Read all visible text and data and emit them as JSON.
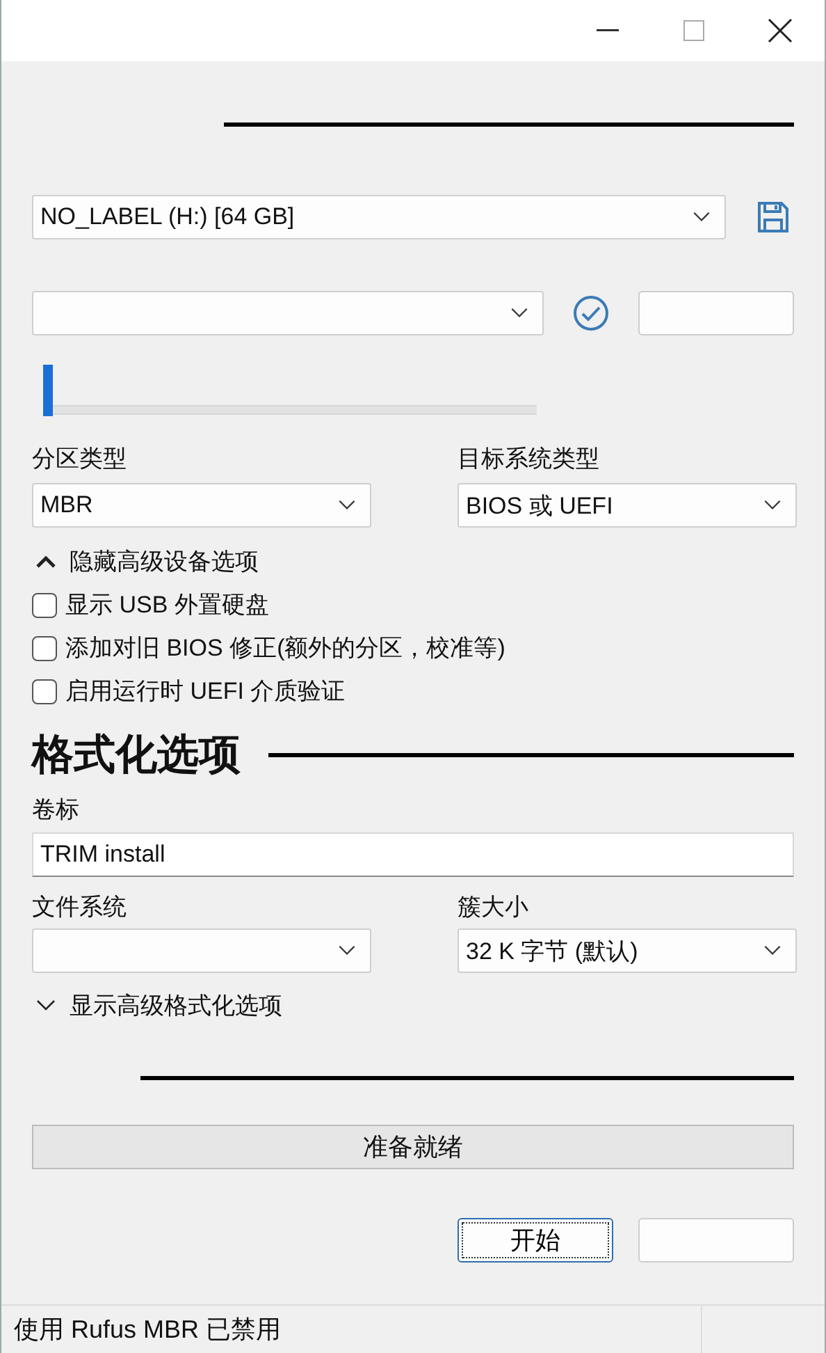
{
  "drive_properties": {
    "device": {
      "value": "NO_LABEL (H:) [64 GB]"
    },
    "persistence": {
      "level": 0
    },
    "partition_scheme": {
      "label": "分区类型",
      "value": "MBR"
    },
    "target_system": {
      "label": "目标系统类型",
      "value": "BIOS 或 UEFI"
    },
    "advanced_toggle": {
      "label": "隐藏高级设备选项",
      "expanded": true
    },
    "options": [
      {
        "label": "显示 USB 外置硬盘",
        "checked": false
      },
      {
        "label": "添加对旧 BIOS 修正(额外的分区，校准等)",
        "checked": false
      },
      {
        "label": "启用运行时 UEFI 介质验证",
        "checked": false
      }
    ]
  },
  "format_options": {
    "title": "格式化选项",
    "volume_label": {
      "label": "卷标",
      "value": "TRIM install"
    },
    "file_system": {
      "label": "文件系统"
    },
    "cluster_size": {
      "label": "簇大小",
      "value": "32 K 字节 (默认)"
    },
    "advanced_toggle": {
      "label": "显示高级格式化选项",
      "expanded": false
    }
  },
  "status": {
    "text": "准备就绪"
  },
  "buttons": [
    {
      "label": "开始",
      "focused": true
    }
  ],
  "status_bar": {
    "text": "使用 Rufus MBR 已禁用"
  }
}
